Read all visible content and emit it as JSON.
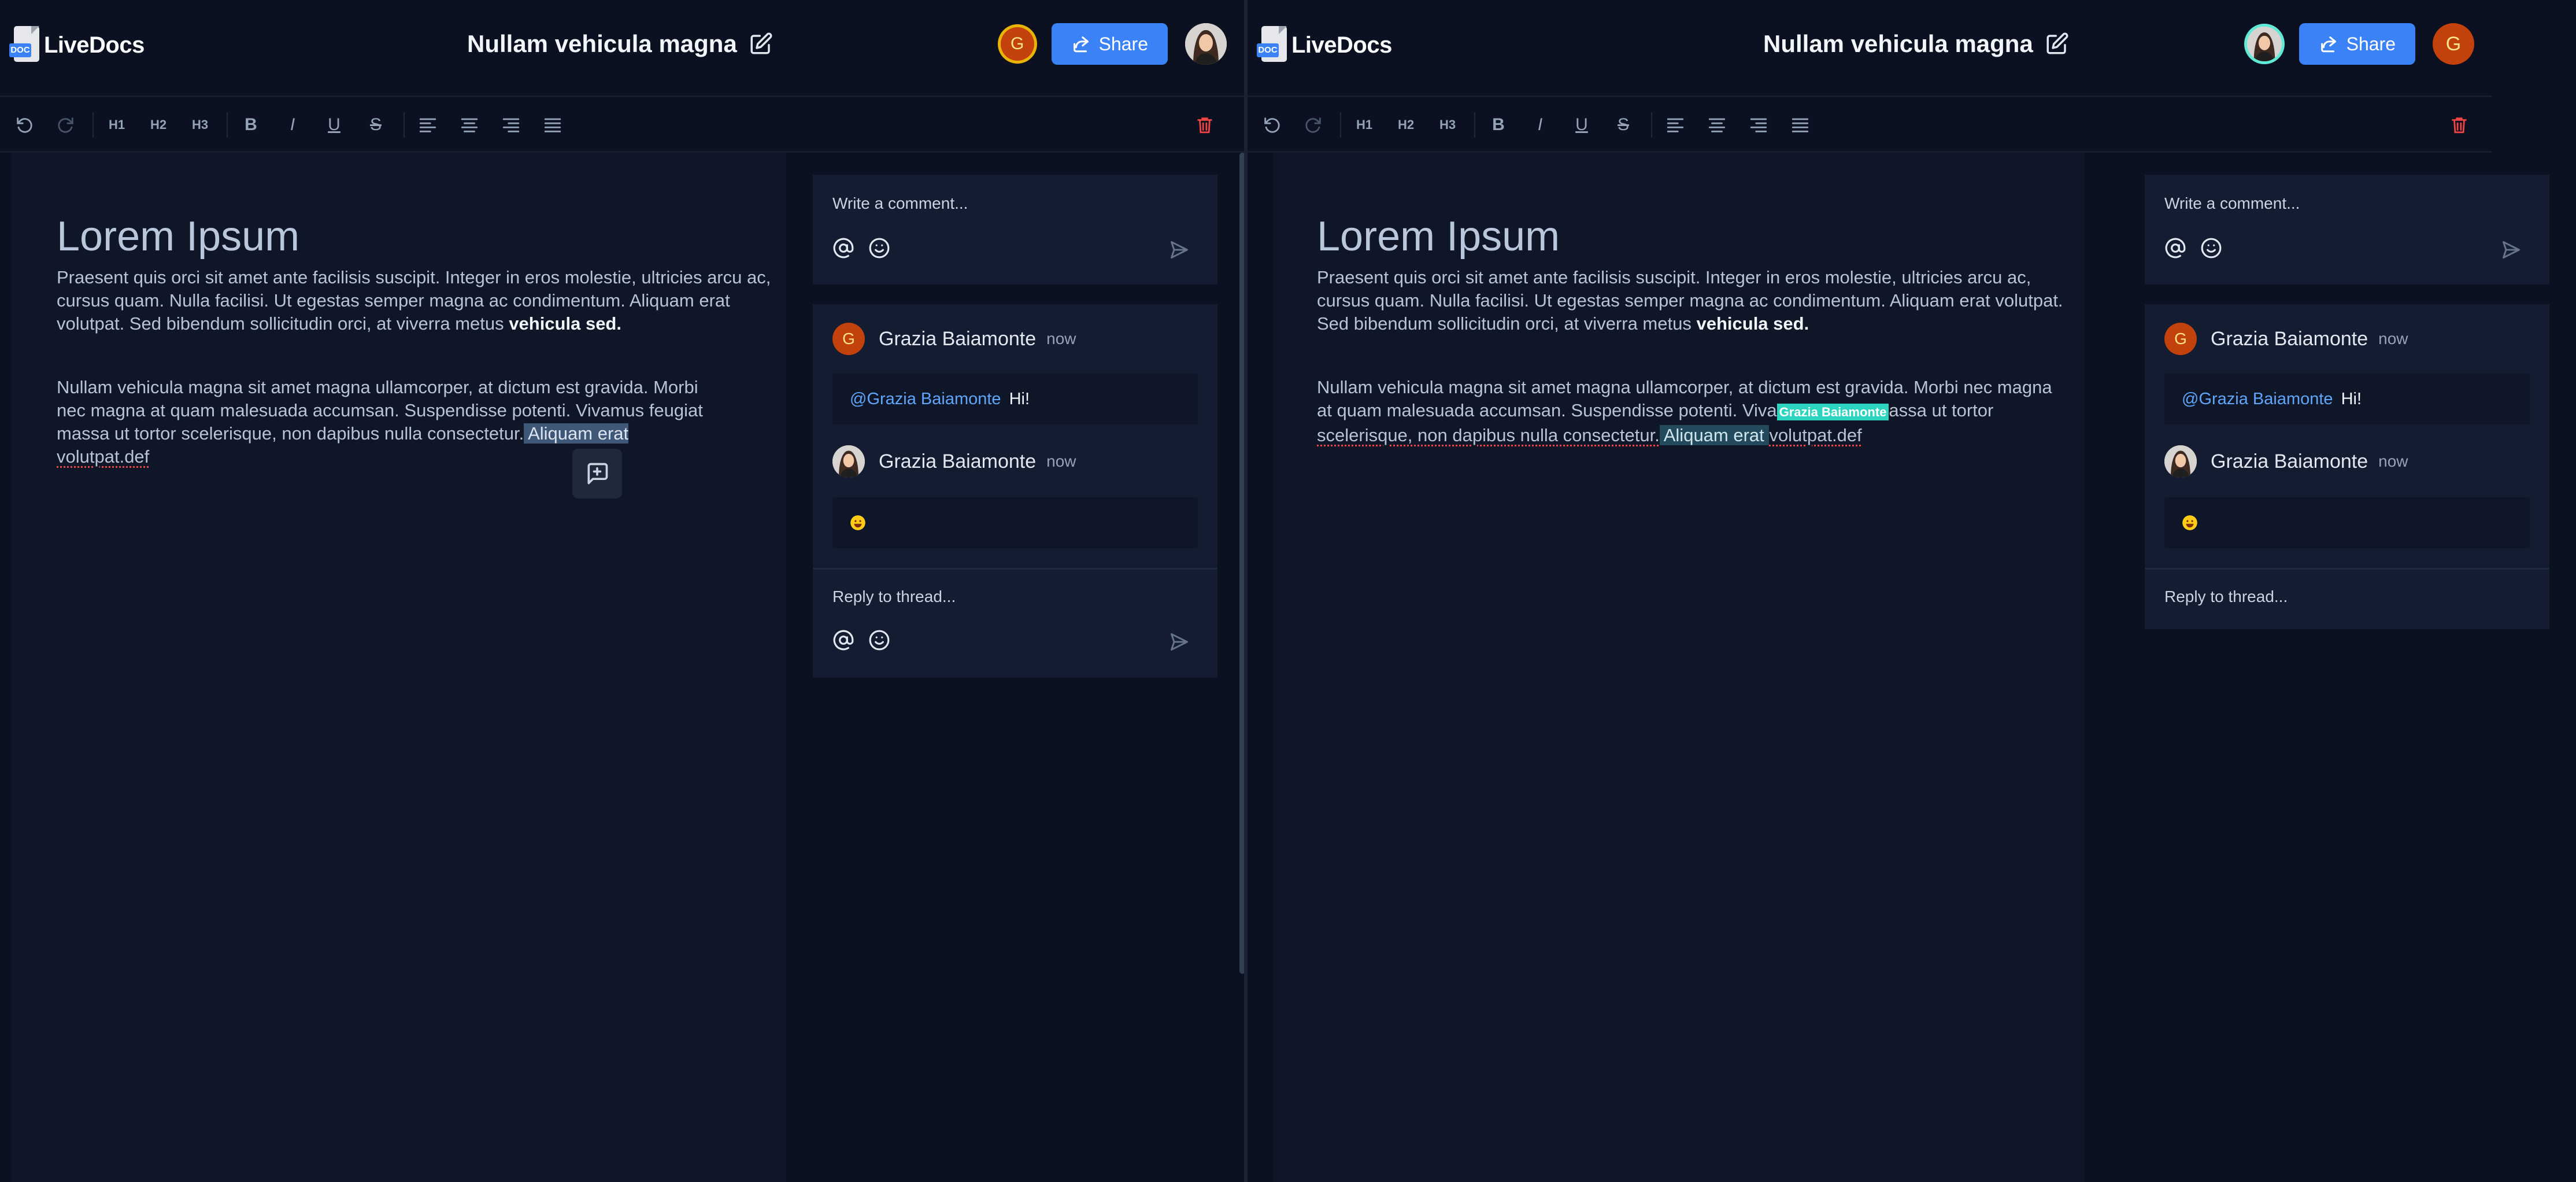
{
  "app": {
    "name": "LiveDocs",
    "logo_tag": "DOC"
  },
  "document": {
    "title": "Nullam vehicula magna",
    "heading": "Lorem Ipsum",
    "paragraph1": "Praesent quis orci sit amet ante facilisis suscipit. Integer in eros molestie, ultricies arcu ac, cursus quam. Nulla facilisi. Ut egestas semper magna ac condimentum. Aliquam erat volutpat. Sed bibendum sollicitudin orci, at viverra metus",
    "paragraph1_bold": "vehicula sed.",
    "paragraph2_left": {
      "line1": "Nullam vehicula magna sit amet magna ullamcorper, at dictum est gravida. Morbi",
      "line2": "nec magna at quam malesuada accumsan. Suspendisse potenti. Vivamus feugiat",
      "line3": "massa ut tortor scelerisque, non dapibus nulla consectetur.",
      "selected": " Aliquam erat",
      "line4": "volutpat.def"
    },
    "paragraph2_right": {
      "line1": "Nullam vehicula magna sit amet magna ullamcorper, at dictum est gravida. Morbi nec magna",
      "line2_start": "at quam malesuada accumsan. Suspendisse potenti. Viva",
      "cursor_label": "Grazia Baiamonte",
      "line2_end": "assa ut tortor",
      "line3_start": "scelerisque, non dapibus nulla consectetur.",
      "highlighted": " Aliquam erat ",
      "line3_end": "volutpat.def"
    }
  },
  "header": {
    "share_label": "Share",
    "avatar_initial": "G"
  },
  "toolbar": {
    "h1": "H1",
    "h2": "H2",
    "h3": "H3",
    "bold": "B",
    "italic": "I",
    "underline": "U",
    "strike": "S"
  },
  "comments": {
    "composer_placeholder": "Write a comment...",
    "reply_placeholder": "Reply to thread...",
    "thread": [
      {
        "author": "Grazia Baiamonte",
        "time": "now",
        "mention": "@Grazia Baiamonte",
        "text": "Hi!"
      },
      {
        "author": "Grazia Baiamonte",
        "time": "now",
        "emoji": "grinning-face"
      }
    ]
  },
  "colors": {
    "accent": "#3b82f6",
    "background": "#0b1120",
    "panel": "#131c30",
    "avatar": "#c2410c",
    "presence_left": "#eab308",
    "presence_right": "#5eead4",
    "delete": "#ef4444"
  }
}
